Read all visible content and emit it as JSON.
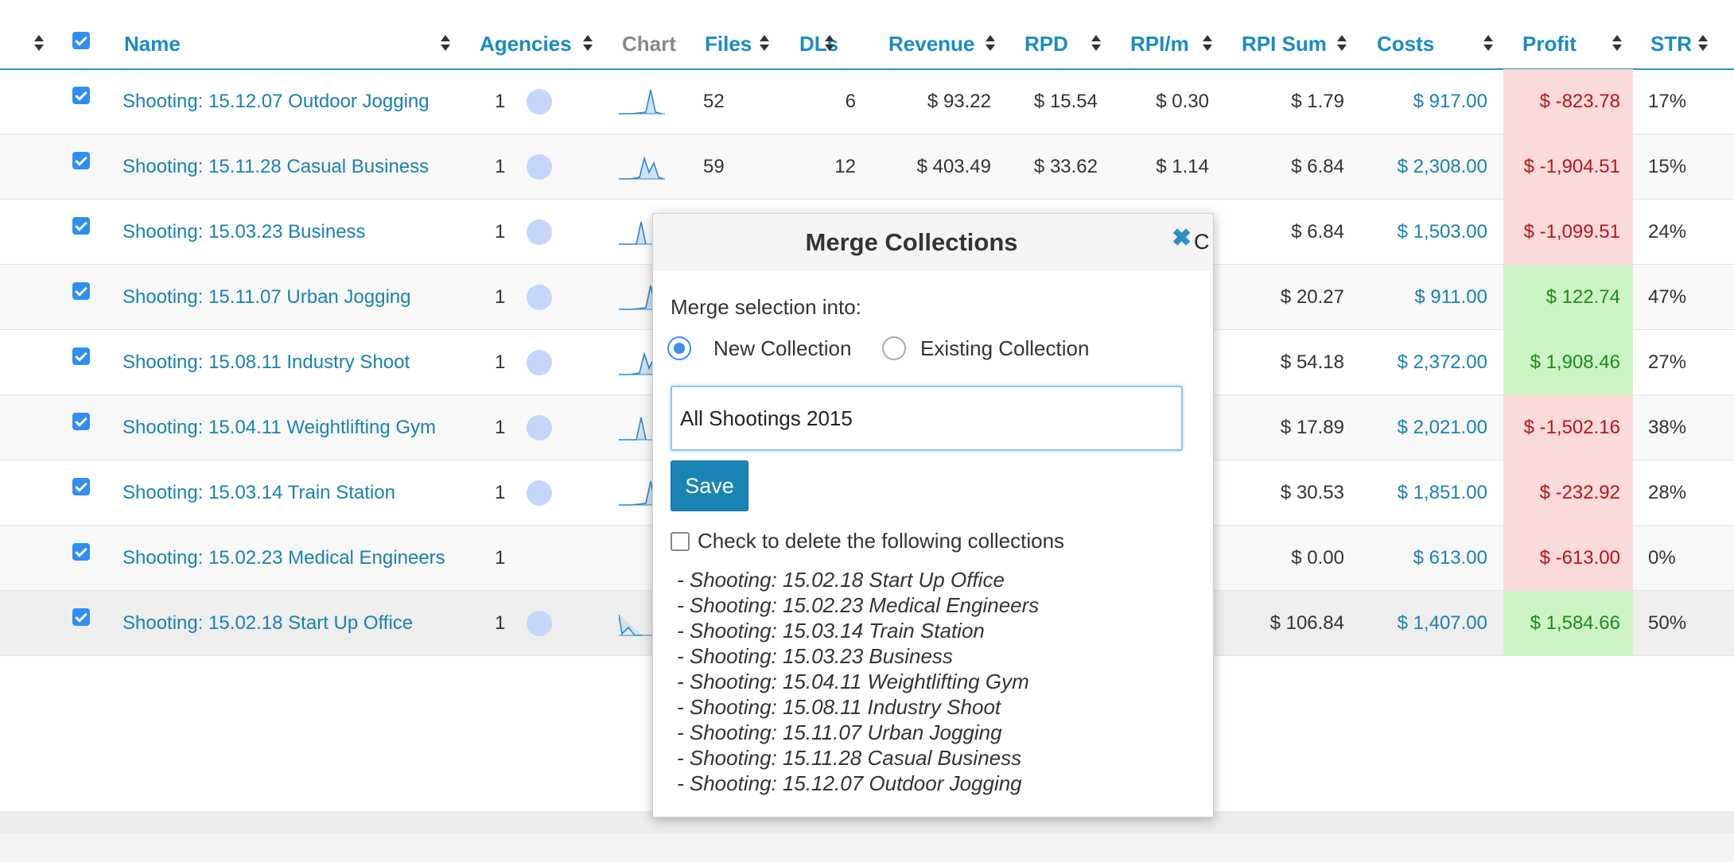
{
  "table": {
    "headers": {
      "name": "Name",
      "agencies": "Agencies",
      "chart": "Chart",
      "files": "Files",
      "dls": "DLs",
      "revenue": "Revenue",
      "rpd": "RPD",
      "rpim": "RPI/m",
      "rpisum": "RPI Sum",
      "costs": "Costs",
      "profit": "Profit",
      "str": "STR"
    },
    "rows": [
      {
        "name": "Shooting: 15.12.07 Outdoor Jogging",
        "agencies": "1",
        "files": "52",
        "dls": "6",
        "revenue": "$ 93.22",
        "rpd": "$ 15.54",
        "rpim": "$ 0.30",
        "rpisum": "$ 1.79",
        "costs": "$ 917.00",
        "profit": "$ -823.78",
        "profit_status": "negative",
        "str": "17%"
      },
      {
        "name": "Shooting: 15.11.28 Casual Business",
        "agencies": "1",
        "files": "59",
        "dls": "12",
        "revenue": "$ 403.49",
        "rpd": "$ 33.62",
        "rpim": "$ 1.14",
        "rpisum": "$ 6.84",
        "costs": "$ 2,308.00",
        "profit": "$ -1,904.51",
        "profit_status": "negative",
        "str": "15%"
      },
      {
        "name": "Shooting: 15.03.23 Business",
        "agencies": "1",
        "files": "",
        "dls": "",
        "revenue": "",
        "rpd": "",
        "rpim": "",
        "rpisum": "$ 6.84",
        "costs": "$ 1,503.00",
        "profit": "$ -1,099.51",
        "profit_status": "negative",
        "str": "24%"
      },
      {
        "name": "Shooting: 15.11.07 Urban Jogging",
        "agencies": "1",
        "files": "",
        "dls": "",
        "revenue": "",
        "rpd": "",
        "rpim": "",
        "rpisum": "$ 20.27",
        "costs": "$ 911.00",
        "profit": "$ 122.74",
        "profit_status": "positive",
        "str": "47%"
      },
      {
        "name": "Shooting: 15.08.11 Industry Shoot",
        "agencies": "1",
        "files": "",
        "dls": "",
        "revenue": "",
        "rpd": "",
        "rpim": "",
        "rpisum": "$ 54.18",
        "costs": "$ 2,372.00",
        "profit": "$ 1,908.46",
        "profit_status": "positive",
        "str": "27%"
      },
      {
        "name": "Shooting: 15.04.11 Weightlifting Gym",
        "agencies": "1",
        "files": "",
        "dls": "",
        "revenue": "",
        "rpd": "",
        "rpim": "",
        "rpisum": "$ 17.89",
        "costs": "$ 2,021.00",
        "profit": "$ -1,502.16",
        "profit_status": "negative",
        "str": "38%"
      },
      {
        "name": "Shooting: 15.03.14 Train Station",
        "agencies": "1",
        "files": "",
        "dls": "",
        "revenue": "",
        "rpd": "",
        "rpim": "",
        "rpisum": "$ 30.53",
        "costs": "$ 1,851.00",
        "profit": "$ -232.92",
        "profit_status": "negative",
        "str": "28%"
      },
      {
        "name": "Shooting: 15.02.23 Medical Engineers",
        "agencies": "1",
        "files": "",
        "dls": "",
        "revenue": "",
        "rpd": "",
        "rpim": "",
        "rpisum": "$ 0.00",
        "costs": "$ 613.00",
        "profit": "$ -613.00",
        "profit_status": "negative",
        "str": "0%"
      },
      {
        "name": "Shooting: 15.02.18 Start Up Office",
        "agencies": "1",
        "files": "",
        "dls": "",
        "revenue": "",
        "rpd": "",
        "rpim": "",
        "rpisum": "$ 106.84",
        "costs": "$ 1,407.00",
        "profit": "$ 1,584.66",
        "profit_status": "positive",
        "str": "50%"
      }
    ]
  },
  "modal": {
    "title": "Merge Collections",
    "close_label": "C",
    "merge_label": "Merge selection into:",
    "option_new": "New Collection",
    "option_existing": "Existing Collection",
    "selected_option": "new",
    "name_value": "All Shootings 2015",
    "save_label": "Save",
    "delete_label": "Check to delete the following collections",
    "collections": [
      "- Shooting: 15.02.18 Start Up Office",
      "- Shooting: 15.02.23 Medical Engineers",
      "- Shooting: 15.03.14 Train Station",
      "- Shooting: 15.03.23 Business",
      "- Shooting: 15.04.11 Weightlifting Gym",
      "- Shooting: 15.08.11 Industry Shoot",
      "- Shooting: 15.11.07 Urban Jogging",
      "- Shooting: 15.11.28 Casual Business",
      "- Shooting: 15.12.07 Outdoor Jogging"
    ]
  },
  "colors": {
    "link": "#1a82ad",
    "header_accent": "#1a8cc1",
    "checkbox": "#2f8ef2",
    "profit_negative_bg": "#fbdada",
    "profit_positive_bg": "#cdf5c4",
    "save_button": "#1a85b5"
  }
}
